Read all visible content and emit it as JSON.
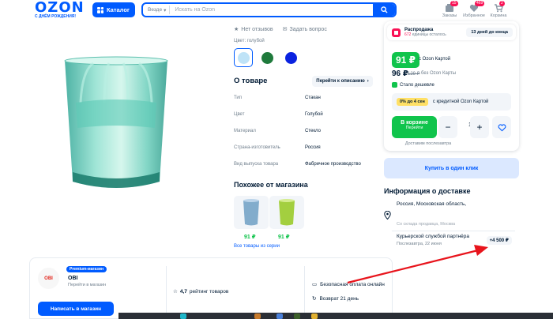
{
  "header": {
    "logo": "OZON",
    "logo_sub": "С ДНЁМ РОЖДЕНИЯ!",
    "catalog_label": "Каталог",
    "search_scope": "Везде",
    "search_placeholder": "Искать на Ozon",
    "icons": [
      {
        "name": "orders",
        "label": "Заказы",
        "badge": "15"
      },
      {
        "name": "favorites",
        "label": "Избранное",
        "badge": "469"
      },
      {
        "name": "cart",
        "label": "Корзина",
        "badge": "2"
      }
    ]
  },
  "product": {
    "no_reviews": "Нет отзывов",
    "ask_question": "Задать вопрос",
    "color_label": "Цвет: голубой",
    "swatch_colors": [
      "#bfe3f7",
      "#1f7a3c",
      "#0a22e0"
    ],
    "about_title": "О товаре",
    "desc_button": "Перейти к описанию",
    "specs": [
      {
        "k": "Тип",
        "v": "Стакан"
      },
      {
        "k": "Цвет",
        "v": "Голубой"
      },
      {
        "k": "Материал",
        "v": "Стекло"
      },
      {
        "k": "Страна-изготовитель",
        "v": "Россия"
      },
      {
        "k": "Вид выпуска товара",
        "v": "Фабричное производство"
      }
    ]
  },
  "similar": {
    "title": "Похожее от магазина",
    "items": [
      {
        "price": "91 ₽"
      },
      {
        "price": "91 ₽"
      }
    ],
    "link": "Все товары из серии"
  },
  "buy": {
    "sale_title": "Распродажа",
    "sale_count": "672",
    "sale_sub": " единицы осталось",
    "sale_days": "13 дней до конца",
    "price_card": "91 ₽",
    "price_card_label": "с Ozon Картой",
    "price": "96 ₽",
    "price_old": "129 ₽",
    "price_label": "без Ozon Карты",
    "cheaper": "Стало дешевле",
    "credit_tag": "0% до 4 сен",
    "credit_text": "с кредитной Ozon Картой",
    "cart_label": "В корзине",
    "cart_sub": "Перейти",
    "qty_minus": "−",
    "qty": "1",
    "qty_plus": "+",
    "deliver_note": "Доставим послезавтра",
    "one_click": "Купить в один клик"
  },
  "delivery": {
    "title": "Информация о доставке",
    "region": "Россия, Московская область,",
    "warehouse": "Со склада продавца, Москва",
    "option_title": "Курьерской службой партнёра",
    "option_date": "Послезавтра, 22 июня",
    "option_price": "+4 500 ₽"
  },
  "seller": {
    "premium": "Premium-магазин",
    "logo_text": "OBI",
    "name": "OBI",
    "sub": "Перейти в магазин",
    "write": "Написать в магазин",
    "rating_value": "4,7",
    "rating_text": "рейтинг товаров",
    "safe": "Безопасная оплата онлайн",
    "return": "Возврат 21 день"
  }
}
